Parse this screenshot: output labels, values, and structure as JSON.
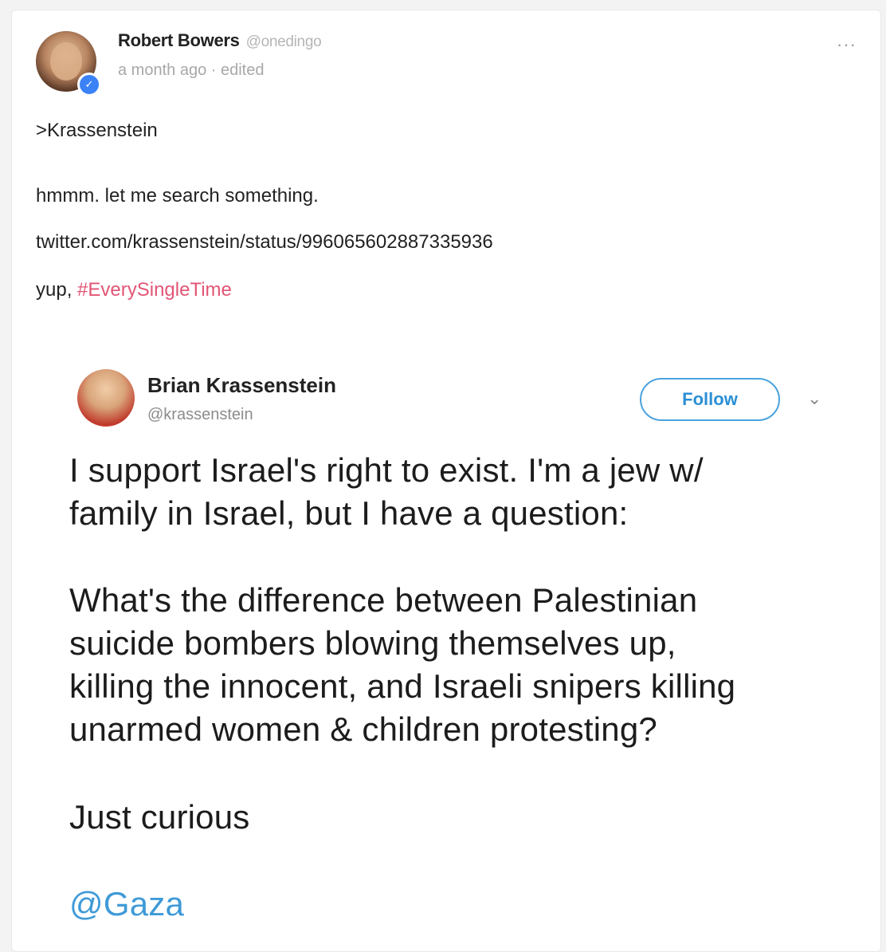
{
  "comment": {
    "author": "Robert Bowers",
    "handle": "@onedingo",
    "meta": "a month ago · edited",
    "more": "···",
    "lines": [
      ">Krassenstein",
      "hmmm. let me search something.",
      "twitter.com/krassenstein/status/996065602887335936"
    ],
    "last_line_prefix": "yup, ",
    "hashtag": "#EverySingleTime"
  },
  "tweet": {
    "name": "Brian Krassenstein",
    "handle": "@krassenstein",
    "follow_label": "Follow",
    "chevron": "⌄",
    "text_lines": [
      "I support Israel's right to exist. I'm a jew w/",
      "family in Israel, but I have a question:",
      "What's the difference between Palestinian",
      "suicide bombers blowing themselves up,",
      "killing the innocent, and Israeli snipers killing",
      "unarmed women & children protesting?",
      "Just curious"
    ],
    "mention": "@Gaza"
  },
  "colors": {
    "hashtag": "#e25575",
    "follow": "#2b8fd6",
    "mention": "#3f9ad8",
    "verified": "#3b82f6"
  },
  "icons": [
    "verified-icon",
    "more-options-icon",
    "chevron-down-icon"
  ]
}
